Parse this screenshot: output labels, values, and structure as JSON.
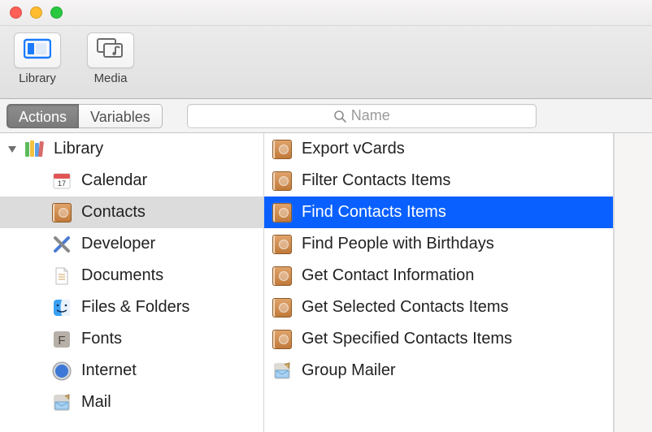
{
  "traffic_lights": {
    "close": "#fe5f57",
    "min": "#febc2e",
    "zoom": "#28c840"
  },
  "toolbar": {
    "library_label": "Library",
    "media_label": "Media"
  },
  "tabs": {
    "actions": "Actions",
    "variables": "Variables",
    "active": "actions"
  },
  "search": {
    "placeholder": "Name"
  },
  "sidebar": {
    "root": {
      "label": "Library",
      "expanded": true
    },
    "items": [
      {
        "label": "Calendar",
        "icon": "calendar"
      },
      {
        "label": "Contacts",
        "icon": "contacts",
        "selected": true
      },
      {
        "label": "Developer",
        "icon": "xcode"
      },
      {
        "label": "Documents",
        "icon": "document"
      },
      {
        "label": "Files & Folders",
        "icon": "finder"
      },
      {
        "label": "Fonts",
        "icon": "fontbook"
      },
      {
        "label": "Internet",
        "icon": "safari"
      },
      {
        "label": "Mail",
        "icon": "mail"
      }
    ]
  },
  "actions": {
    "items": [
      {
        "label": "Export vCards",
        "icon": "contactbook"
      },
      {
        "label": "Filter Contacts Items",
        "icon": "contactbook"
      },
      {
        "label": "Find Contacts Items",
        "icon": "contactbook",
        "selected": true
      },
      {
        "label": "Find People with Birthdays",
        "icon": "contactbook"
      },
      {
        "label": "Get Contact Information",
        "icon": "contactbook"
      },
      {
        "label": "Get Selected Contacts Items",
        "icon": "contactbook"
      },
      {
        "label": "Get Specified Contacts Items",
        "icon": "contactbook"
      },
      {
        "label": "Group Mailer",
        "icon": "mailer"
      }
    ]
  }
}
